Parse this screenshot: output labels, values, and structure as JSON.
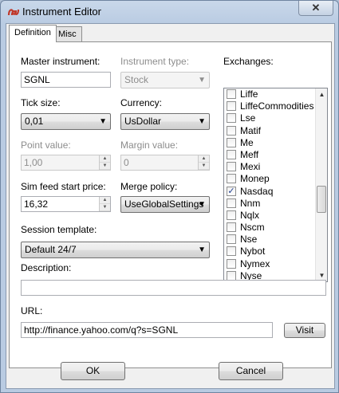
{
  "window": {
    "title": "Instrument Editor",
    "close_label": "✕"
  },
  "tabs": [
    {
      "label": "Definition",
      "active": true
    },
    {
      "label": "Misc",
      "active": false
    }
  ],
  "form": {
    "master_instrument": {
      "label": "Master instrument:",
      "value": "SGNL"
    },
    "instrument_type": {
      "label": "Instrument type:",
      "value": "Stock",
      "enabled": false
    },
    "tick_size": {
      "label": "Tick size:",
      "value": "0,01"
    },
    "currency": {
      "label": "Currency:",
      "value": "UsDollar"
    },
    "point_value": {
      "label": "Point value:",
      "value": "1,00",
      "enabled": false
    },
    "margin_value": {
      "label": "Margin value:",
      "value": "0",
      "enabled": false
    },
    "sim_feed_start_price": {
      "label": "Sim feed start price:",
      "value": "16,32"
    },
    "merge_policy": {
      "label": "Merge policy:",
      "value": "UseGlobalSettings"
    },
    "session_template": {
      "label": "Session template:",
      "value": "Default 24/7"
    },
    "description": {
      "label": "Description:",
      "value": ""
    },
    "url": {
      "label": "URL:",
      "value": "http://finance.yahoo.com/q?s=SGNL",
      "visit_label": "Visit"
    }
  },
  "exchanges": {
    "label": "Exchanges:",
    "items": [
      {
        "name": "Liffe",
        "checked": false
      },
      {
        "name": "LiffeCommodities",
        "checked": false
      },
      {
        "name": "Lse",
        "checked": false
      },
      {
        "name": "Matif",
        "checked": false
      },
      {
        "name": "Me",
        "checked": false
      },
      {
        "name": "Meff",
        "checked": false
      },
      {
        "name": "Mexi",
        "checked": false
      },
      {
        "name": "Monep",
        "checked": false
      },
      {
        "name": "Nasdaq",
        "checked": true
      },
      {
        "name": "Nnm",
        "checked": false
      },
      {
        "name": "Nqlx",
        "checked": false
      },
      {
        "name": "Nscm",
        "checked": false
      },
      {
        "name": "Nse",
        "checked": false
      },
      {
        "name": "Nybot",
        "checked": false
      },
      {
        "name": "Nymex",
        "checked": false
      },
      {
        "name": "Nyse",
        "checked": false
      }
    ]
  },
  "footer": {
    "ok_label": "OK",
    "cancel_label": "Cancel"
  },
  "icons": {
    "app": "ninja-logo-icon",
    "dropdown": "chevron-down-icon",
    "check": "checkmark-icon"
  },
  "colors": {
    "accent": "#b9cbe2",
    "check": "#1e3e90"
  }
}
